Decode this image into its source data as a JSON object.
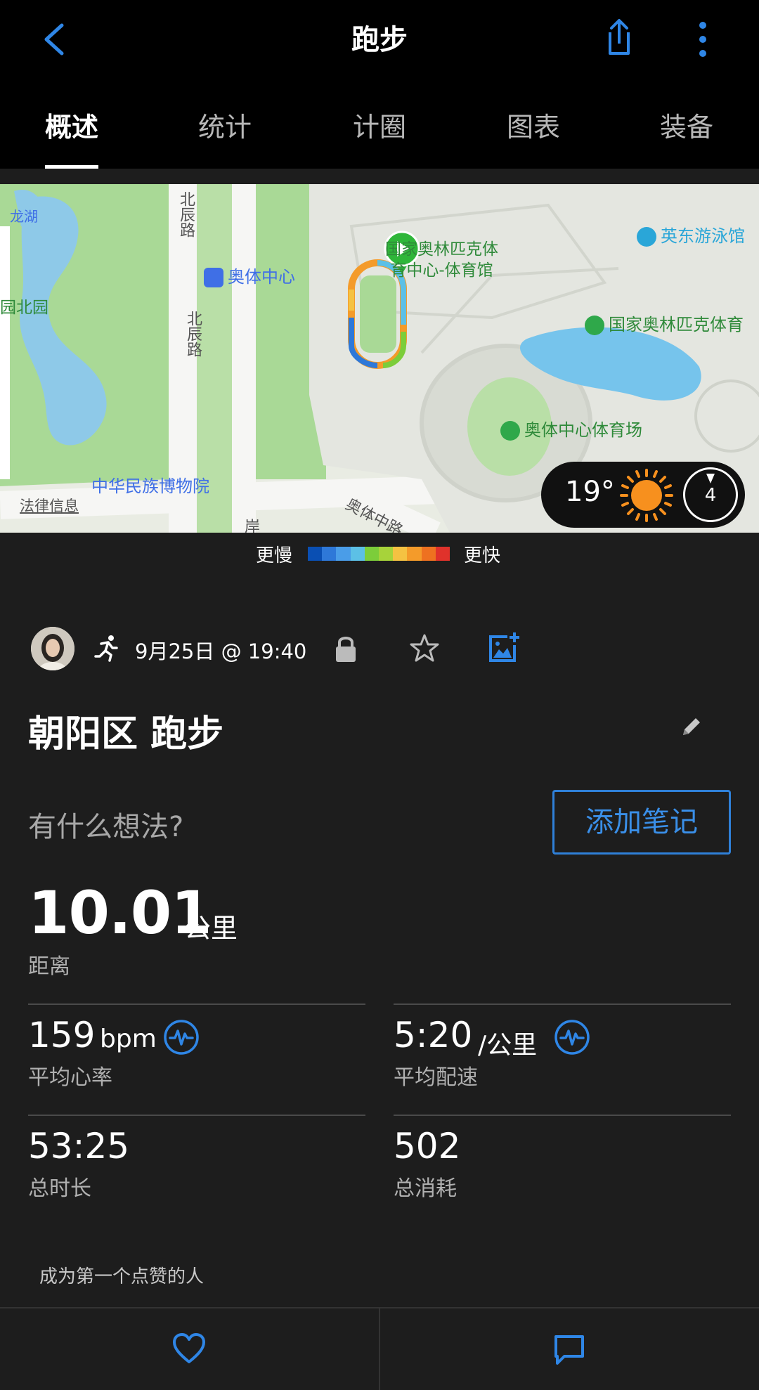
{
  "header": {
    "title": "跑步",
    "back_icon": "chevron-left-icon",
    "share_icon": "share-icon",
    "more_icon": "more-vertical-icon"
  },
  "tabs": [
    {
      "label": "概述",
      "active": true
    },
    {
      "label": "统计",
      "active": false
    },
    {
      "label": "计圈",
      "active": false
    },
    {
      "label": "图表",
      "active": false
    },
    {
      "label": "装备",
      "active": false
    }
  ],
  "map": {
    "labels": {
      "longhu": "龙湖",
      "beichen1": "北辰路",
      "beichen2": "北辰路",
      "aoti_center": "奥体中心",
      "beiyuan": "园北园",
      "gym_line1": "国家奥林匹克体",
      "gym_line2": "育中心-体育馆",
      "swim": "英东游泳馆",
      "olympic_right": "国家奥林匹克体育",
      "stadium": "奥体中心体育场",
      "museum": "中华民族博物院",
      "legal": "法律信息",
      "aoti_road": "奥体中路",
      "cut_char": "岸"
    },
    "weather": {
      "temperature": "19°",
      "sun_icon": "sun-icon",
      "moon_phase": "4"
    }
  },
  "legend": {
    "slower": "更慢",
    "faster": "更快",
    "colors": [
      "#0a4fb3",
      "#2e78d8",
      "#4a9de8",
      "#5cc0e6",
      "#7ccd3a",
      "#a7d33a",
      "#f5c242",
      "#f49b2a",
      "#ee7120",
      "#e0322b"
    ]
  },
  "activity": {
    "run_icon": "running-icon",
    "date": "9月25日 @ 19:40",
    "lock_icon": "lock-icon",
    "star_icon": "star-icon",
    "add_photo_icon": "add-photo-icon",
    "title": "朝阳区 跑步",
    "edit_icon": "pencil-icon",
    "thoughts_prompt": "有什么想法?",
    "add_note": "添加笔记"
  },
  "stats": {
    "distance": {
      "value": "10.01",
      "unit": "公里",
      "label": "距离"
    },
    "heart_rate": {
      "value": "159",
      "unit": "bpm",
      "label": "平均心率"
    },
    "pace": {
      "value": "5:20",
      "unit": "/公里",
      "label": "平均配速"
    },
    "duration": {
      "value": "53:25",
      "label": "总时长"
    },
    "calories": {
      "value": "502",
      "label": "总消耗"
    }
  },
  "social": {
    "likes_text": "成为第一个点赞的人",
    "like_icon": "heart-icon",
    "comment_icon": "comment-icon"
  },
  "colors": {
    "accent_blue": "#2f80d8",
    "background": "#1d1d1d",
    "top_bar": "#000000",
    "route_start_green": "#2fb63a"
  }
}
